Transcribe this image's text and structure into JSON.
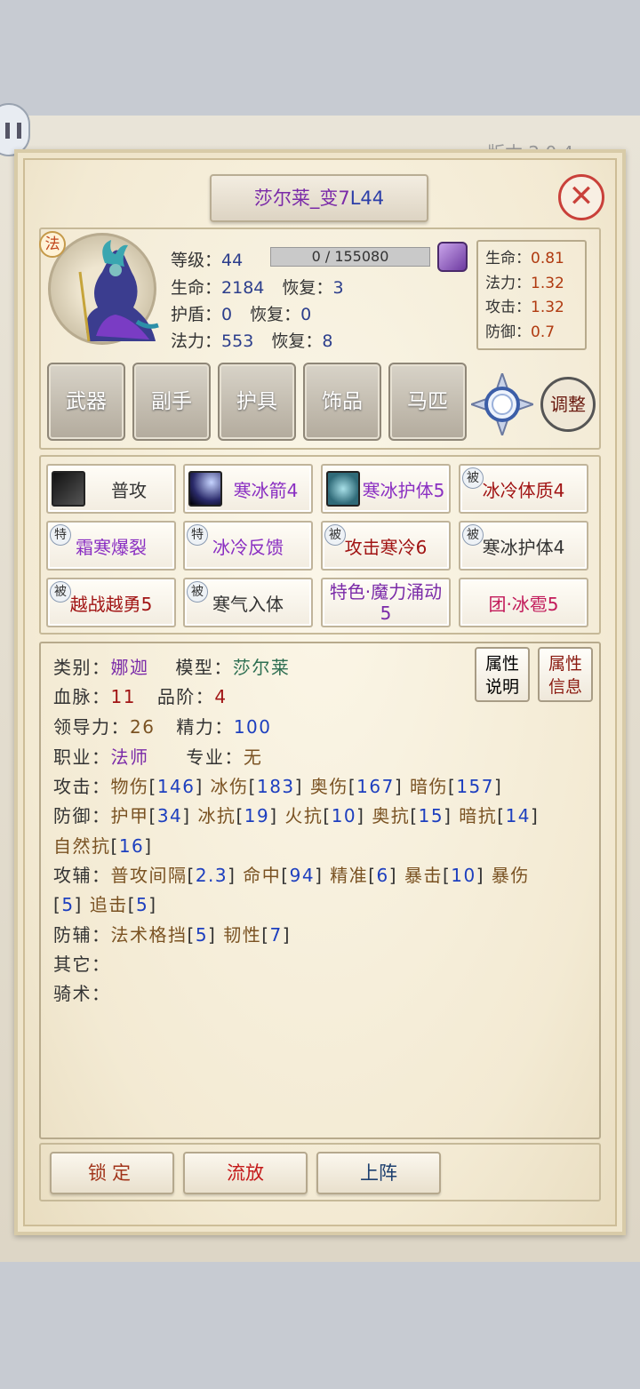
{
  "version_text": "版本 2.0.4",
  "title": {
    "name": "莎尔莱_变7",
    "level": "L44"
  },
  "close_symbol": "✕",
  "class_badge": "法",
  "stats": {
    "level_label": "等级：",
    "level_value": "44",
    "exp_text": "0 / 155080",
    "hp_label": "生命：",
    "hp_value": "2184",
    "hp_regen_label": "恢复：",
    "hp_regen_value": "3",
    "shield_label": "护盾：",
    "shield_value": "0",
    "shield_regen_label": "恢复：",
    "shield_regen_value": "0",
    "mp_label": "法力：",
    "mp_value": "553",
    "mp_regen_label": "恢复：",
    "mp_regen_value": "8"
  },
  "growth": [
    {
      "label": "生命：",
      "value": "0.81"
    },
    {
      "label": "法力：",
      "value": "1.32"
    },
    {
      "label": "攻击：",
      "value": "1.32"
    },
    {
      "label": "防御：",
      "value": "0.7"
    }
  ],
  "equipment": [
    "武器",
    "副手",
    "护具",
    "饰品",
    "马匹"
  ],
  "adjust_label": "调整",
  "skills": [
    {
      "name": "普攻",
      "tag": "",
      "color": "#333333"
    },
    {
      "name": "寒冰箭4",
      "tag": "",
      "color": "#8a2fc2"
    },
    {
      "name": "寒冰护体5",
      "tag": "",
      "color": "#8a2fc2"
    },
    {
      "name": "冰冷体质4",
      "tag": "被",
      "color": "#a11414"
    },
    {
      "name": "霜寒爆裂",
      "tag": "特",
      "color": "#8a2fc2"
    },
    {
      "name": "冰冷反馈",
      "tag": "特",
      "color": "#8a2fc2"
    },
    {
      "name": "攻击寒冷6",
      "tag": "被",
      "color": "#a11414"
    },
    {
      "name": "寒冰护体4",
      "tag": "被",
      "color": "#333333"
    },
    {
      "name": "越战越勇5",
      "tag": "被",
      "color": "#a11414"
    },
    {
      "name": "寒气入体",
      "tag": "被",
      "color": "#333333"
    },
    {
      "name": "特色·魔力涌动5",
      "tag": "",
      "color": "#7a2aa8"
    },
    {
      "name": "团·冰雹5",
      "tag": "",
      "color": "#c21a5a"
    }
  ],
  "info": {
    "category_label": "类别：",
    "category_value": "娜迦",
    "model_label": "模型：",
    "model_value": "莎尔莱",
    "bloodline_label": "血脉：",
    "bloodline_value": "11",
    "grade_label": "品阶：",
    "grade_value": "4",
    "leadership_label": "领导力：",
    "leadership_value": "26",
    "energy_label": "精力：",
    "energy_value": "100",
    "job_label": "职业：",
    "job_value": "法师",
    "spec_label": "专业：",
    "spec_value": "无",
    "attack_label": "攻击：",
    "attack_items": [
      {
        "name": "物伤",
        "value": "146"
      },
      {
        "name": "冰伤",
        "value": "183"
      },
      {
        "name": "奥伤",
        "value": "167"
      },
      {
        "name": "暗伤",
        "value": "157"
      }
    ],
    "defense_label": "防御：",
    "defense_items": [
      {
        "name": "护甲",
        "value": "34"
      },
      {
        "name": "冰抗",
        "value": "19"
      },
      {
        "name": "火抗",
        "value": "10"
      },
      {
        "name": "奥抗",
        "value": "15"
      },
      {
        "name": "暗抗",
        "value": "14"
      },
      {
        "name": "自然抗",
        "value": "16"
      }
    ],
    "atk_aux_label": "攻辅：",
    "atk_aux_items": [
      {
        "name": "普攻间隔",
        "value": "2.3"
      },
      {
        "name": "命中",
        "value": "94"
      },
      {
        "name": "精准",
        "value": "6"
      },
      {
        "name": "暴击",
        "value": "10"
      },
      {
        "name": "暴伤",
        "value": "5"
      },
      {
        "name": "追击",
        "value": "5"
      }
    ],
    "def_aux_label": "防辅：",
    "def_aux_items": [
      {
        "name": "法术格挡",
        "value": "5"
      },
      {
        "name": "韧性",
        "value": "7"
      }
    ],
    "other_label": "其它：",
    "riding_label": "骑术："
  },
  "attr_buttons": [
    {
      "line1": "属性",
      "line2": "说明"
    },
    {
      "line1": "属性",
      "line2": "信息"
    }
  ],
  "actions": {
    "lock": "锁定",
    "exile": "流放",
    "deploy": "上阵"
  }
}
